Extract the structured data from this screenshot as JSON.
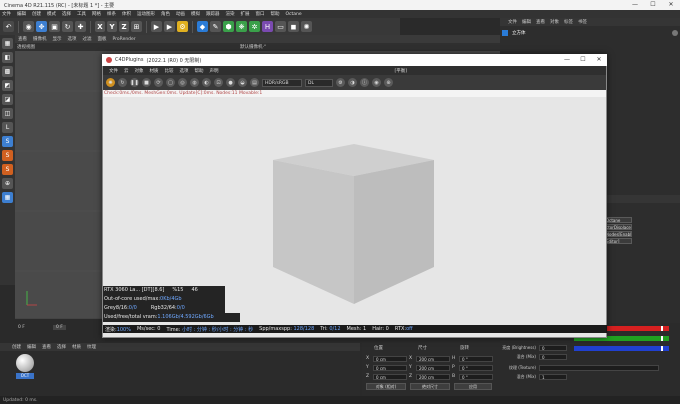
{
  "app": {
    "title": "Cinema 4D R21.115 (RC) - [未标题 1 *] - 主要",
    "window_controls": [
      "—",
      "☐",
      "✕"
    ]
  },
  "main_menu": [
    "文件",
    "编辑",
    "创建",
    "模式",
    "选择",
    "工具",
    "网格",
    "样条",
    "体积",
    "运动图形",
    "角色",
    "动画",
    "模拟",
    "跟踪器",
    "渲染",
    "扩展",
    "窗口",
    "帮助",
    "Octane"
  ],
  "toolbar": {
    "axis_buttons": [
      "X",
      "Y",
      "Z"
    ]
  },
  "viewport": {
    "menu": [
      "查看",
      "摄像机",
      "显示",
      "选项",
      "过滤",
      "面板",
      "ProRender"
    ],
    "camera_label": "透视视图",
    "default_camera": "默认摄像机·°"
  },
  "right_panel": {
    "menu": [
      "文件",
      "编辑",
      "查看",
      "对象",
      "标签",
      "书签"
    ],
    "object_name": "立方体",
    "tags": [
      "Octane",
      "ctorDisplacement",
      "Nodes[Enable]",
      "Editor]"
    ]
  },
  "octane_window": {
    "title": "C4DPlugins",
    "subtitle": "(2022.1 (R0) 0 无限制)",
    "menu": [
      "文件",
      "云",
      "对象",
      "材质",
      "比较",
      "选项",
      "帮助",
      "声明"
    ],
    "tab_label": "[平衡]",
    "color_space": "HDR/sRGB",
    "display_mode": "DL",
    "info_line": "Check:0ms./0ms. MeshGen:0ms. Update[C]:0ms. Nodes:11 Movable:1",
    "stats": {
      "gpu": "RTX 3060 La... [DT][8.6]",
      "gpu_pct": "%15",
      "gpu_temp": "46",
      "out_of_core_label": "Out-of-core used/max:",
      "out_of_core_value": "0Kb/4Gb",
      "grey_label": "Grey8/16:",
      "grey_value": "0/0",
      "rgb_label": "Rgb32/64:",
      "rgb_value": "0/0",
      "vram_label": "Used/free/total vram:",
      "vram_value": "1.106Gb/4.592Gb/6Gb"
    },
    "status_bar": {
      "render_label": "渲染:",
      "render_value": "100%",
      "ms_label": "Ms/sec:",
      "ms_value": "0",
      "time_label": "Time:",
      "time_value": "小时 : 分钟 : 秒/小时 : 分钟 : 秒",
      "spp_label": "Spp/maxspp:",
      "spp_value": "128/128",
      "tri_label": "Tri:",
      "tri_value": "0/12",
      "mesh_label": "Mesh:",
      "mesh_value": "1",
      "hair_label": "Hair:",
      "hair_value": "0",
      "rtx_label": "RTX:",
      "rtx_value": "off"
    }
  },
  "timeline": {
    "start": "0 F",
    "frame": "0 F"
  },
  "material_manager": {
    "menu": [
      "创建",
      "编辑",
      "查看",
      "选择",
      "材质",
      "纹理"
    ],
    "material_name": "OCT"
  },
  "coordinates": {
    "header_position": "位置",
    "header_size": "尺寸",
    "header_rotation": "旋转",
    "rows": [
      {
        "axis": "X",
        "pos": "0 cm",
        "size_axis": "X",
        "size": "200 cm",
        "rot_axis": "H",
        "rot": "0 °"
      },
      {
        "axis": "Y",
        "pos": "0 cm",
        "size_axis": "Y",
        "size": "200 cm",
        "rot_axis": "P",
        "rot": "0 °"
      },
      {
        "axis": "Z",
        "pos": "0 cm",
        "size_axis": "Z",
        "size": "200 cm",
        "rot_axis": "B",
        "rot": "0 °"
      }
    ],
    "mode_select": "对象 (相对)",
    "size_select": "绝对尺寸",
    "apply_button": "应用"
  },
  "attributes": {
    "rows": [
      {
        "label": "混合 (Mix)",
        "value": "0"
      },
      {
        "label": "亮度 (Brightness)",
        "value": "0"
      },
      {
        "label": "纹理 (Texture)",
        "value": ""
      },
      {
        "label": "混合 (Mix)",
        "value": "1"
      }
    ],
    "color_channels": [
      "#d62020",
      "#20a020",
      "#2040d0"
    ]
  },
  "statusbar": {
    "text": "Updated: 0 ms."
  }
}
